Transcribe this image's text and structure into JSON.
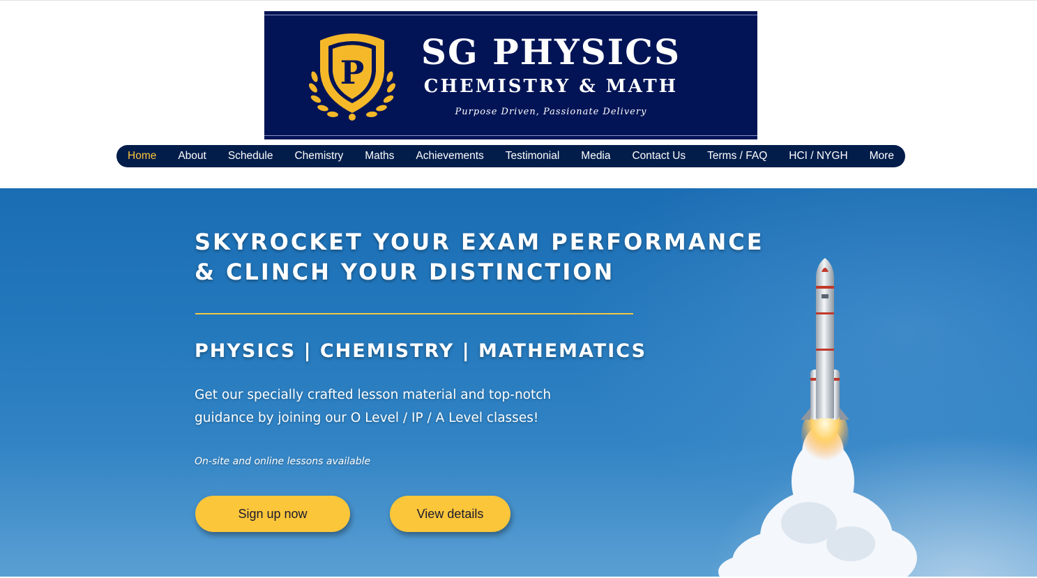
{
  "logo": {
    "crest_letter": "P",
    "title": "SG PHYSICS",
    "subtitle": "CHEMISTRY & MATH",
    "tagline": "Purpose Driven, Passionate Delivery",
    "colors": {
      "background": "#031456",
      "gold": "#f5b829"
    }
  },
  "nav": {
    "items": [
      {
        "label": "Home",
        "active": true
      },
      {
        "label": "About"
      },
      {
        "label": "Schedule"
      },
      {
        "label": "Chemistry"
      },
      {
        "label": "Maths"
      },
      {
        "label": "Achievements"
      },
      {
        "label": "Testimonial"
      },
      {
        "label": "Media"
      },
      {
        "label": "Contact Us"
      },
      {
        "label": "Terms / FAQ"
      },
      {
        "label": "HCI / NYGH"
      },
      {
        "label": "More"
      }
    ],
    "colors": {
      "background": "#031d4b",
      "active": "#fcc63a"
    }
  },
  "hero": {
    "title_line1": "SKYROCKET YOUR EXAM PERFORMANCE",
    "title_line2": "& CLINCH YOUR DISTINCTION",
    "subjects": "PHYSICS | CHEMISTRY | MATHEMATICS",
    "description": "Get our specially crafted lesson material and top-notch guidance by joining our O Level / IP / A Level classes!",
    "note": "On-site and online lessons available",
    "buttons": {
      "signup_label": "Sign up now",
      "details_label": "View details"
    },
    "image": "rocket-launch-image",
    "colors": {
      "accent": "#fcc63a",
      "sky": "#2378bc"
    }
  }
}
